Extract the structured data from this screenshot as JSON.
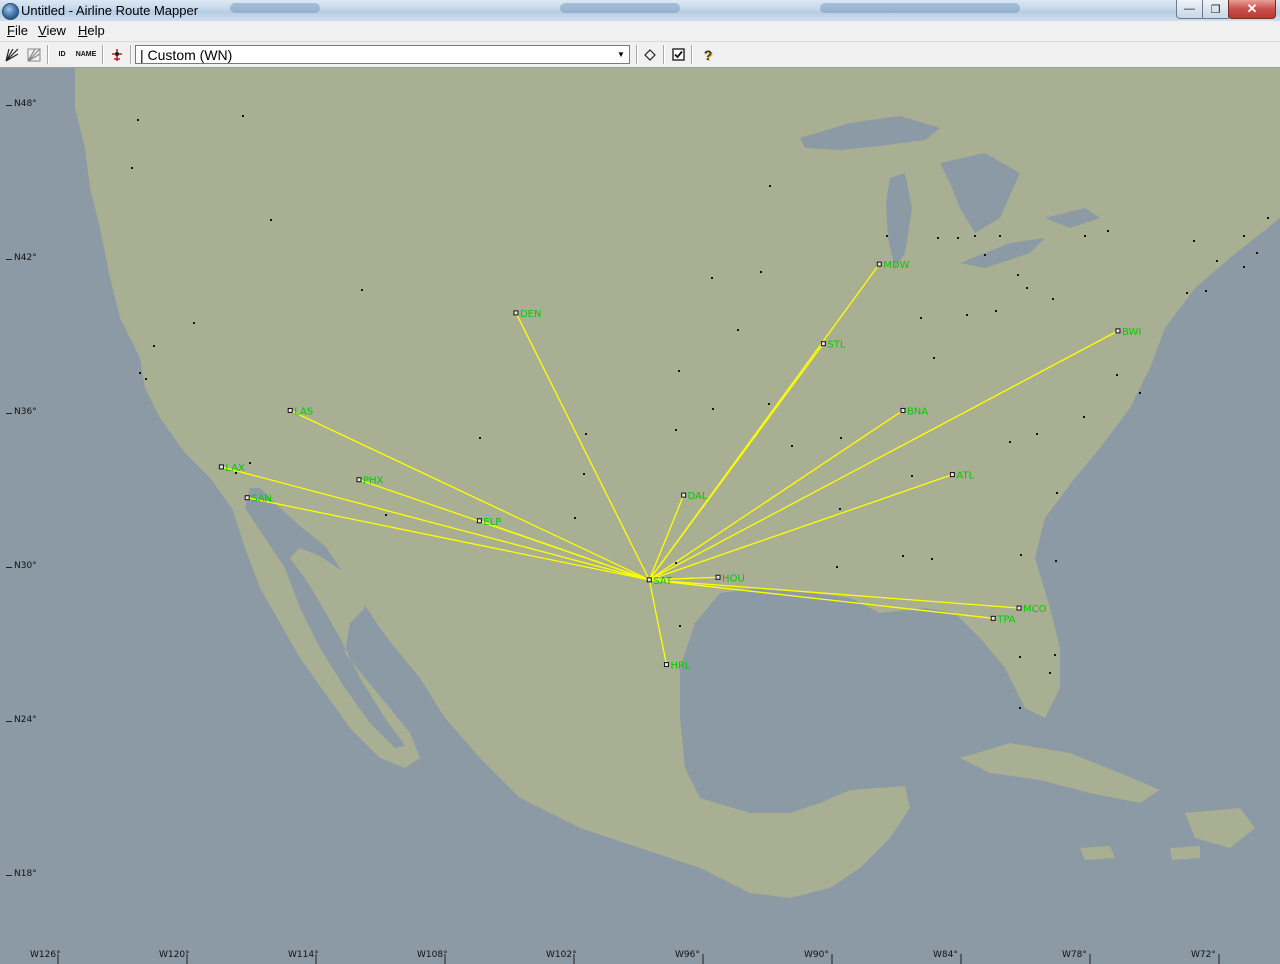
{
  "window": {
    "title": "Untitled - Airline Route Mapper",
    "minimize_glyph": "—",
    "maximize_glyph": "❐",
    "close_glyph": "✕"
  },
  "menu": {
    "file": {
      "accel": "F",
      "rest": "ile"
    },
    "view": {
      "accel": "V",
      "rest": "iew"
    },
    "help": {
      "accel": "H",
      "rest": "elp"
    }
  },
  "toolbar": {
    "icons": [
      "route-tool-icon",
      "grid-tool-icon",
      "id-label-icon",
      "name-label-icon",
      "airport-marker-icon",
      "diamond-icon",
      "checkbox-icon",
      "help-icon"
    ],
    "id_text": "ID",
    "name_text": "NAME",
    "airline_select": {
      "selected": "| Custom (WN)",
      "arrow": "▼"
    },
    "help_glyph": "?"
  },
  "map": {
    "colors": {
      "water": "#8b9aa5",
      "land": "#a9af92",
      "route": "#ffff00",
      "airport_label": "#00cc00",
      "airport_marker": "#111111"
    },
    "lat_labels": [
      "N48°",
      "N42°",
      "N36°",
      "N30°",
      "N24°",
      "N18°"
    ],
    "lon_labels": [
      "W126°",
      "W120°",
      "W114°",
      "W108°",
      "W102°",
      "W96°",
      "W90°",
      "W84°",
      "W78°",
      "W72°"
    ],
    "hub": "SAT",
    "airports": [
      {
        "code": "SAT",
        "lat": 29.5,
        "lon": -98.5
      },
      {
        "code": "DEN",
        "lat": 39.9,
        "lon": -104.7
      },
      {
        "code": "LAS",
        "lat": 36.1,
        "lon": -115.2
      },
      {
        "code": "LAX",
        "lat": 33.9,
        "lon": -118.4
      },
      {
        "code": "SAN",
        "lat": 32.7,
        "lon": -117.2
      },
      {
        "code": "PHX",
        "lat": 33.4,
        "lon": -112.0
      },
      {
        "code": "ELP",
        "lat": 31.8,
        "lon": -106.4
      },
      {
        "code": "DAL",
        "lat": 32.8,
        "lon": -96.9
      },
      {
        "code": "HOU",
        "lat": 29.6,
        "lon": -95.3
      },
      {
        "code": "HRL",
        "lat": 26.2,
        "lon": -97.7
      },
      {
        "code": "MDW",
        "lat": 41.8,
        "lon": -87.8
      },
      {
        "code": "STL",
        "lat": 38.7,
        "lon": -90.4
      },
      {
        "code": "BNA",
        "lat": 36.1,
        "lon": -86.7
      },
      {
        "code": "BWI",
        "lat": 39.2,
        "lon": -76.7
      },
      {
        "code": "ATL",
        "lat": 33.6,
        "lon": -84.4
      },
      {
        "code": "MCO",
        "lat": 28.4,
        "lon": -81.3
      },
      {
        "code": "TPA",
        "lat": 28.0,
        "lon": -82.5
      }
    ]
  }
}
